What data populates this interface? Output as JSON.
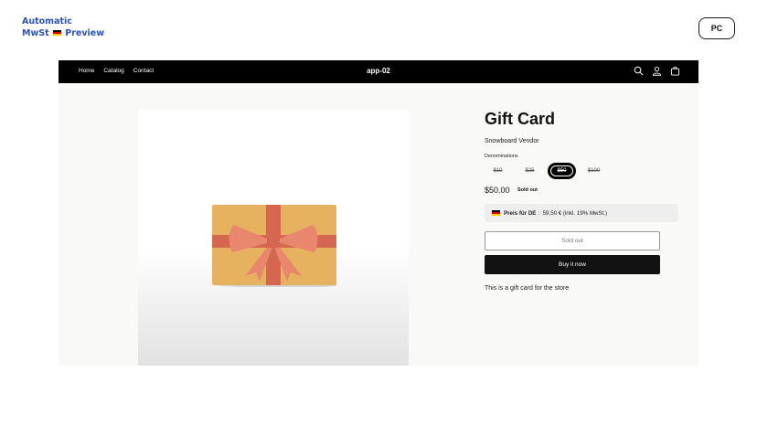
{
  "brand": {
    "line1": "Automatic",
    "line2_before": "MwSt",
    "line2_after": "Preview"
  },
  "view_toggle": {
    "label": "PC"
  },
  "store": {
    "nav": [
      "Home",
      "Catalog",
      "Contact"
    ],
    "name": "app-02",
    "icons": [
      "search-icon",
      "account-icon",
      "cart-icon"
    ]
  },
  "product": {
    "title": "Gift Card",
    "vendor": "Snowboard Vendor",
    "denominations_label": "Denominations",
    "denominations": [
      "$10",
      "$25",
      "$50",
      "$100"
    ],
    "selected_denomination": "$50",
    "price": "$50.00",
    "badge": "Sold out",
    "mwst": {
      "label": "Preis für DE",
      "separator": ":",
      "value": "59,50 € (inkl. 19% MwSt.)"
    },
    "sold_out_button": "Sold out",
    "buy_button": "Buy it now",
    "description": "This is a gift card for the store"
  },
  "colors": {
    "brand_blue": "#2a52be",
    "header_bg": "#000000",
    "card_gold": "#e7b25f",
    "ribbon": "#d56650",
    "bow": "#e8866e"
  }
}
